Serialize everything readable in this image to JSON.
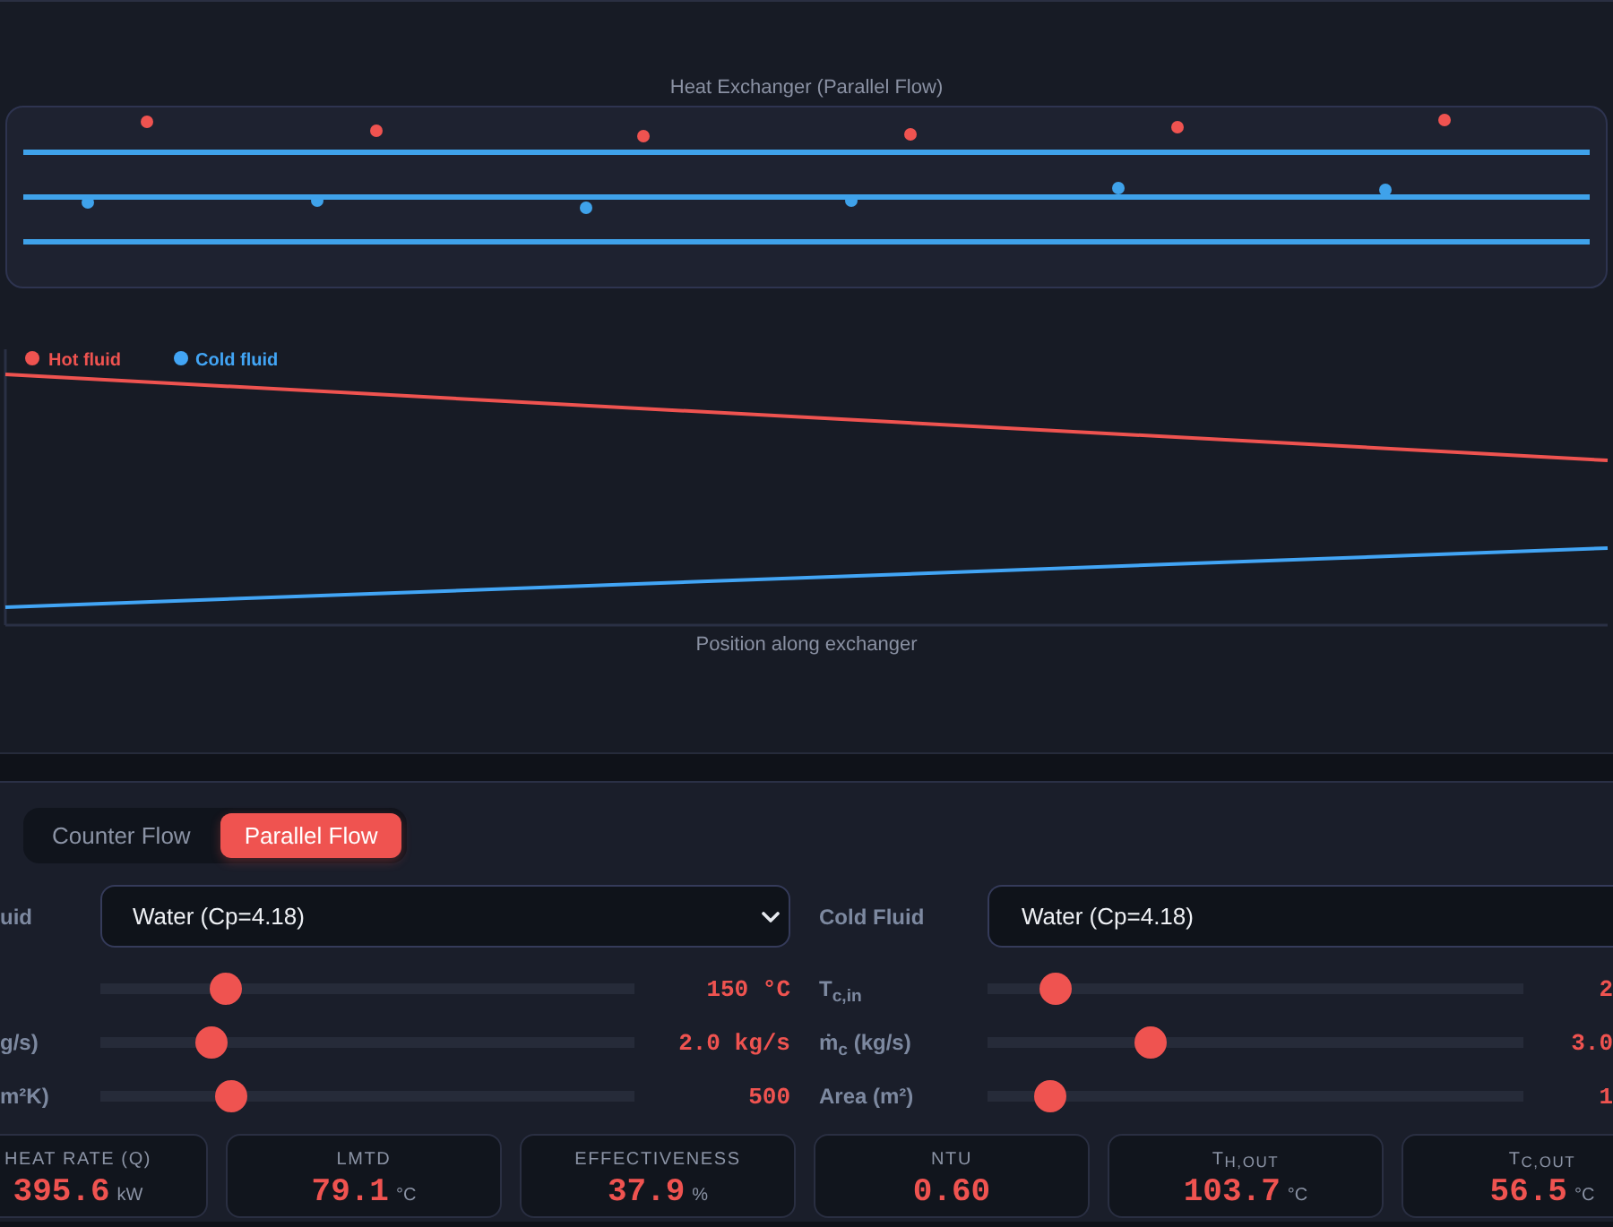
{
  "diagram": {
    "title": "Heat Exchanger (Parallel Flow)"
  },
  "profile_chart": {
    "legend": [
      {
        "label": "Hot fluid",
        "color": "#ef5350"
      },
      {
        "label": "Cold fluid",
        "color": "#42a5f5"
      }
    ],
    "xlabel": "Position along exchanger"
  },
  "flow_modes": [
    {
      "label": "Counter Flow",
      "selected": false
    },
    {
      "label": "Parallel Flow",
      "selected": true
    }
  ],
  "hot_fluid": {
    "label": "uid",
    "fluid": "Water (Cp=4.18)",
    "sliders": [
      {
        "level": 0.218,
        "reading": "150 °C"
      },
      {
        "label": "g/s)",
        "level": 0.189,
        "reading": "2.0 kg/s"
      },
      {
        "label": "m²K)",
        "level": 0.229,
        "reading": "500"
      }
    ]
  },
  "cold_fluid": {
    "label": "Cold Fluid",
    "fluid": "Water (Cp=4.18)",
    "sliders": [
      {
        "label": "T$_{c,in}$",
        "level": 0.103,
        "reading": "2"
      },
      {
        "label": "ṁ$_{c}$ (kg/s)",
        "level": 0.292,
        "reading": "3.0"
      },
      {
        "label": "Area (m²)",
        "level": 0.093,
        "reading": "1"
      }
    ]
  },
  "results": [
    {
      "label": "HEAT RATE (Q)",
      "value": "395.6",
      "unit": "kW"
    },
    {
      "label": "LMTD",
      "value": "79.1",
      "unit": "°C"
    },
    {
      "label": "EFFECTIVENESS",
      "value": "37.9",
      "unit": "%"
    },
    {
      "label": "NTU",
      "value": "0.60"
    },
    {
      "label": "T$_{H,OUT}$",
      "value": "103.7",
      "unit": "°C"
    },
    {
      "label": "T$_{C,OUT}$",
      "value": "56.5",
      "unit": "°C"
    }
  ]
}
